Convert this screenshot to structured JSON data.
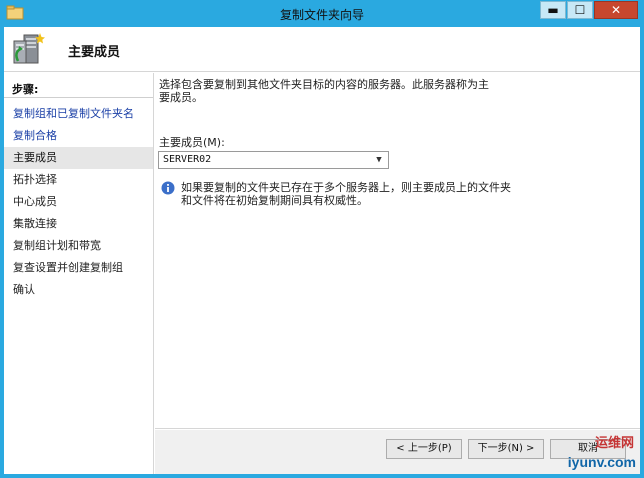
{
  "window": {
    "title": "复制文件夹向导",
    "controls": {
      "minimize": "▬",
      "maximize": "☐",
      "close": "✕"
    }
  },
  "header": {
    "title": "主要成员",
    "icon": "replication-server-icon"
  },
  "nav": {
    "heading": "步骤:",
    "items": [
      {
        "label": "复制组和已复制文件夹名",
        "state": "done"
      },
      {
        "label": "复制合格",
        "state": "done"
      },
      {
        "label": "主要成员",
        "state": "current"
      },
      {
        "label": "拓扑选择",
        "state": "pending"
      },
      {
        "label": "中心成员",
        "state": "pending"
      },
      {
        "label": "集散连接",
        "state": "pending"
      },
      {
        "label": "复制组计划和带宽",
        "state": "pending"
      },
      {
        "label": "复查设置并创建复制组",
        "state": "pending"
      },
      {
        "label": "确认",
        "state": "pending"
      }
    ]
  },
  "content": {
    "description": "选择包含要复制到其他文件夹目标的内容的服务器。此服务器称为主要成员。",
    "primary_member_label": "主要成员(M):",
    "primary_member_value": "SERVER02",
    "info_text": "如果要复制的文件夹已存在于多个服务器上，则主要成员上的文件夹和文件将在初始复制期间具有权威性。"
  },
  "footer": {
    "back_label": "< 上一步(P)",
    "next_label": "下一步(N) >",
    "cancel_label": "取消"
  },
  "watermark": {
    "line1": "运维网",
    "line2": "iyunv.com"
  },
  "colors": {
    "titlebar": "#2aa9e0",
    "link_blue": "#1a3fa6",
    "current_step_bg": "#e6e6e6",
    "close_button": "#c7472e",
    "info_icon": "#3b6fc9"
  }
}
